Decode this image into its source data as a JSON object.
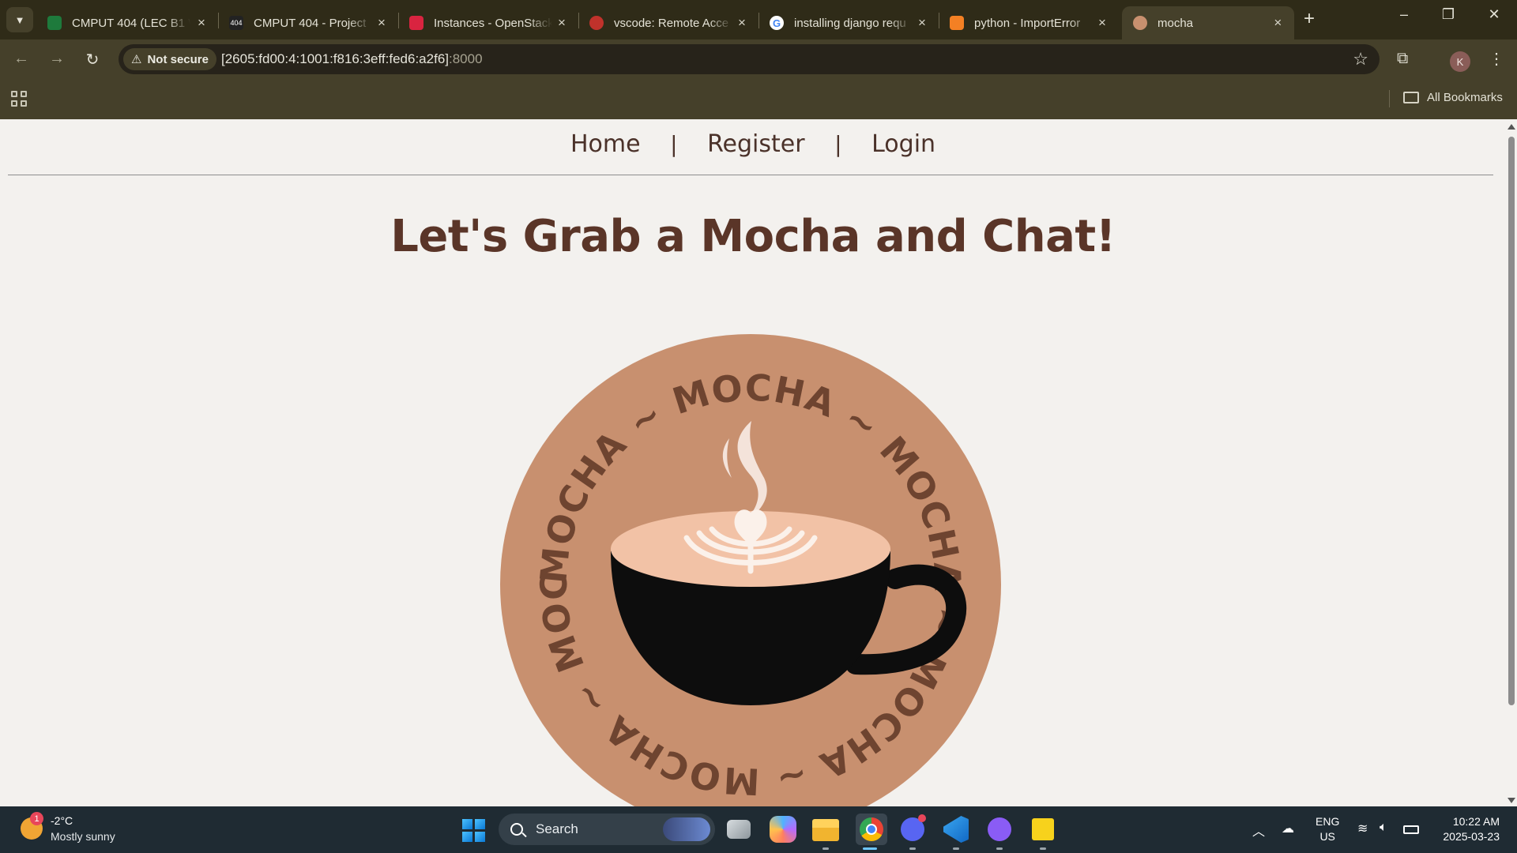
{
  "browser": {
    "tabs": [
      {
        "title": "CMPUT 404 (LEC B1 W",
        "active": false,
        "favicon_color": "#1e7a3c"
      },
      {
        "title": "CMPUT 404 - Project",
        "active": false,
        "favicon_color": "#222222",
        "favicon_text": "404"
      },
      {
        "title": "Instances - OpenStack",
        "active": false,
        "favicon_color": "#d92440"
      },
      {
        "title": "vscode: Remote Acce",
        "active": false,
        "favicon_color": "#c0322b"
      },
      {
        "title": "installing django requ",
        "active": false,
        "favicon_color": "#4285f4"
      },
      {
        "title": "python - ImportError",
        "active": false,
        "favicon_color": "#f48024"
      },
      {
        "title": "mocha",
        "active": true,
        "favicon_color": "#c8906f"
      }
    ],
    "security_label": "Not secure",
    "url_host": "[2605:fd00:4:1001:f816:3eff:fed6:a2f6]",
    "url_port": ":8000",
    "profile_initial": "K",
    "bookmarks_label": "All Bookmarks"
  },
  "site": {
    "nav": {
      "home": "Home",
      "register": "Register",
      "login": "Login",
      "separator": "|"
    },
    "headline": "Let's Grab a Mocha and Chat!",
    "logo": {
      "ring_text": "MOCHA ~ MOCHA ~ MOCHA ~ MOCHA ~ MOCHA ~ MOCHA ~ MOCHA ~ MOCHA ~",
      "badge_color": "#c8906f",
      "text_color": "#6e4430",
      "cup_color": "#0d0d0d",
      "foam_color": "#f2c2a6"
    }
  },
  "taskbar": {
    "weather_badge": "1",
    "temperature": "-2°C",
    "weather_desc": "Mostly sunny",
    "search_label": "Search",
    "lang_line1": "ENG",
    "lang_line2": "US",
    "time": "10:22 AM",
    "date": "2025-03-23"
  }
}
